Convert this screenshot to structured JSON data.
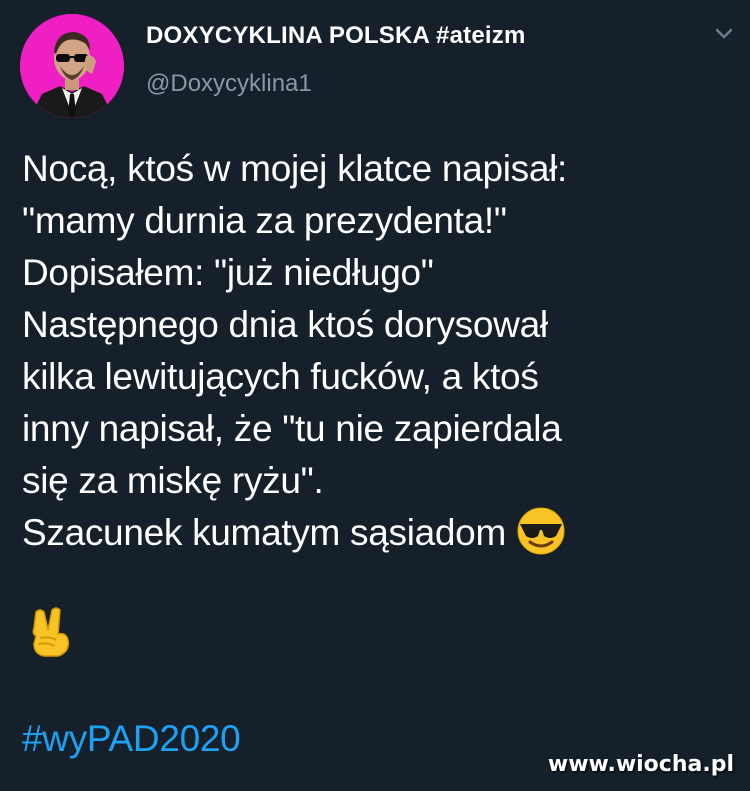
{
  "tweet": {
    "display_name": "DOXYCYKLINA POLSKA #ateizm",
    "handle": "@Doxycyklina1",
    "body_lines": [
      "Nocą, ktoś w mojej klatce napisał:",
      "\"mamy durnia za prezydenta!\"",
      "Dopisałem: \"już niedługo\"",
      "Następnego dnia ktoś dorysował",
      "kilka lewitujących fucków, a ktoś",
      "inny napisał, że \"tu nie zapierdala",
      "się za miskę ryżu\".",
      "Szacunek kumatym sąsiadom"
    ],
    "hashtag": "#wyPAD2020",
    "emojis": [
      "smiling-face-with-sunglasses",
      "victory-hand"
    ]
  },
  "watermark": "www.wiocha.pl",
  "colors": {
    "background": "#15202b",
    "text": "#ffffff",
    "secondary_text": "#8899a6",
    "link": "#1da1f2",
    "avatar_bg": "#ef1fc4"
  }
}
